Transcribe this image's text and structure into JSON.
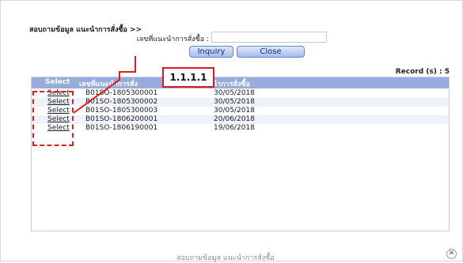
{
  "dialog": {
    "title": "สอบถามข้อมูล แนะนำการสั่งซื้อ >>",
    "search_label": "เลขที่แนะนำการสั่งซื้อ :",
    "search_value": "",
    "inquiry_label": "Inquiry",
    "close_label": "Close",
    "record_count": "Record (s) : 5"
  },
  "table": {
    "headers": [
      "Select",
      "เลขที่แนะนำการสั่ง",
      "นำการสั่งซื้อ"
    ],
    "rows": [
      {
        "select": "Select",
        "no": "B01SO-1805300001",
        "date": "30/05/2018"
      },
      {
        "select": "Select",
        "no": "B01SO-1805300002",
        "date": "30/05/2018"
      },
      {
        "select": "Select",
        "no": "B01SO-1805300003",
        "date": "30/05/2018"
      },
      {
        "select": "Select",
        "no": "B01SO-1806200001",
        "date": "20/06/2018"
      },
      {
        "select": "Select",
        "no": "B01SO-1806190001",
        "date": "19/06/2018"
      }
    ]
  },
  "annotation": {
    "callout_label": "1.1.1.1",
    "color": "#e01b1b"
  },
  "footer": {
    "status_text": "สอบถามข้อมูล แนะนำการสั่งซื้อ",
    "close_glyph": "✕"
  }
}
